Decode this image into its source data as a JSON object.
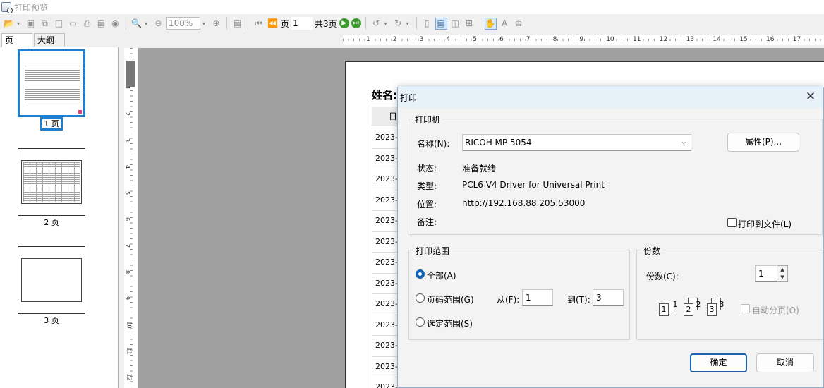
{
  "window": {
    "title": "打印预览"
  },
  "toolbar": {
    "zoom_value": "100%",
    "page_label": "页",
    "page_current": "1",
    "page_total_label": "共3页"
  },
  "left_panel": {
    "tabs": [
      {
        "label": "页"
      },
      {
        "label": "大纲"
      }
    ],
    "thumbnails": [
      {
        "label": "1 页"
      },
      {
        "label": "2 页"
      },
      {
        "label": "3 页"
      }
    ]
  },
  "rulers": {
    "vertical_numbers": [
      "1",
      "2",
      "3",
      "4",
      "5",
      "6",
      "7",
      "8",
      "9",
      "10",
      "11",
      "12"
    ],
    "horizontal_numbers": [
      "1",
      "2",
      "3",
      "4",
      "5",
      "6",
      "7",
      "8",
      "9",
      "10",
      "11",
      "12",
      "13",
      "14",
      "15",
      "16",
      "17"
    ]
  },
  "preview": {
    "title_partial": "姓名:",
    "header_partial": "日",
    "row_values": [
      "2023-",
      "2023-",
      "2023-",
      "2023-",
      "2023-",
      "2023-",
      "2023-",
      "2023-",
      "2023-",
      "2023-",
      "2023-",
      "2023-",
      "2023-"
    ]
  },
  "dialog": {
    "title": "打印",
    "printer_group": "打印机",
    "name_label": "名称(N):",
    "printer_name": "RICOH MP 5054",
    "properties_button": "属性(P)...",
    "status_label": "状态:",
    "status_value": "准备就绪",
    "type_label": "类型:",
    "type_value": "PCL6 V4 Driver for Universal Print",
    "location_label": "位置:",
    "location_value": "http://192.168.88.205:53000",
    "comment_label": "备注:",
    "print_to_file": "打印到文件(L)",
    "range_group": "打印范围",
    "range_all": "全部(A)",
    "range_pages": "页码范围(G)",
    "from_label": "从(F):",
    "from_value": "1",
    "to_label": "到(T):",
    "to_value": "3",
    "range_selection": "选定范围(S)",
    "copies_group": "份数",
    "copies_label": "份数(C):",
    "copies_value": "1",
    "collate_label": "自动分页(O)",
    "collate_pages": [
      "1",
      "1",
      "2",
      "2",
      "3",
      "3"
    ],
    "ok_button": "确定",
    "cancel_button": "取消"
  }
}
